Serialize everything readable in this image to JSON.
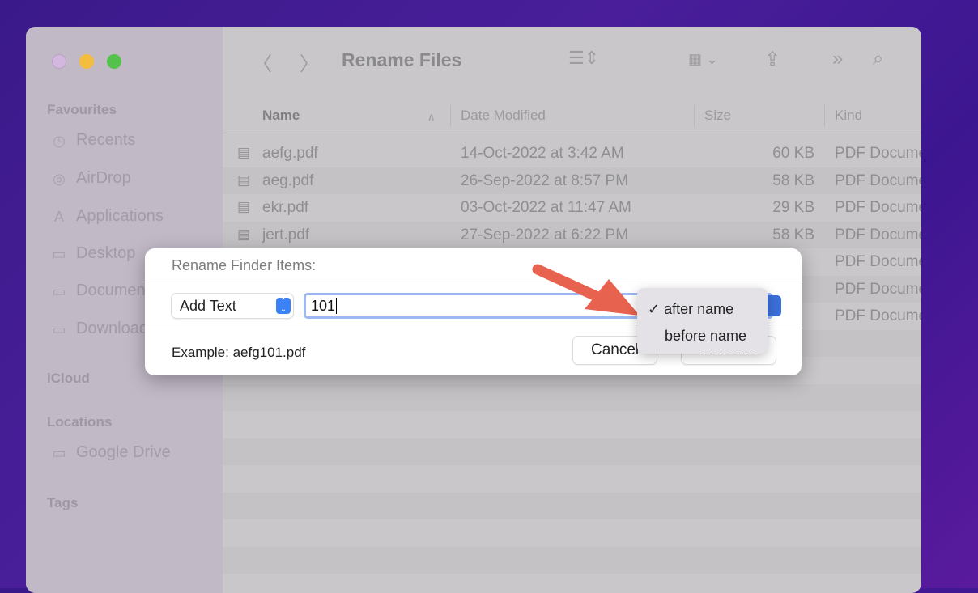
{
  "window": {
    "title": "Rename Files"
  },
  "sidebar": {
    "sections": [
      {
        "label": "Favourites",
        "items": [
          {
            "label": "Recents",
            "icon": "clock-icon"
          },
          {
            "label": "AirDrop",
            "icon": "airdrop-icon"
          },
          {
            "label": "Applications",
            "icon": "applications-icon"
          },
          {
            "label": "Desktop",
            "icon": "folder-icon"
          },
          {
            "label": "Documents",
            "icon": "folder-icon"
          },
          {
            "label": "Downloads",
            "icon": "folder-icon"
          }
        ]
      },
      {
        "label": "iCloud",
        "items": []
      },
      {
        "label": "Locations",
        "items": [
          {
            "label": "Google Drive",
            "icon": "folder-icon"
          }
        ]
      },
      {
        "label": "Tags",
        "items": []
      }
    ]
  },
  "columns": {
    "name": "Name",
    "date": "Date Modified",
    "size": "Size",
    "kind": "Kind"
  },
  "files": [
    {
      "name": "aefg.pdf",
      "date": "14-Oct-2022 at 3:42 AM",
      "size": "60 KB",
      "kind": "PDF Document"
    },
    {
      "name": "aeg.pdf",
      "date": "26-Sep-2022 at 8:57 PM",
      "size": "58 KB",
      "kind": "PDF Document"
    },
    {
      "name": "ekr.pdf",
      "date": "03-Oct-2022 at 11:47 AM",
      "size": "29 KB",
      "kind": "PDF Document"
    },
    {
      "name": "jert.pdf",
      "date": "27-Sep-2022 at 6:22 PM",
      "size": "58 KB",
      "kind": "PDF Document"
    },
    {
      "name": "",
      "date": "",
      "size": "",
      "kind": "PDF Document"
    },
    {
      "name": "",
      "date": "",
      "size": "",
      "kind": "PDF Document"
    },
    {
      "name": "",
      "date": "",
      "size": "",
      "kind": "PDF Document"
    }
  ],
  "dialog": {
    "title": "Rename Finder Items:",
    "mode": "Add Text",
    "text_value": "101",
    "example": "Example: aefg101.pdf",
    "cancel": "Cancel",
    "rename": "Rename"
  },
  "menu": {
    "options": [
      {
        "label": "after name",
        "checked": true
      },
      {
        "label": "before name",
        "checked": false
      }
    ],
    "check": "✓"
  },
  "colors": {
    "accent": "#3b82f6",
    "arrow": "#e8634f"
  }
}
